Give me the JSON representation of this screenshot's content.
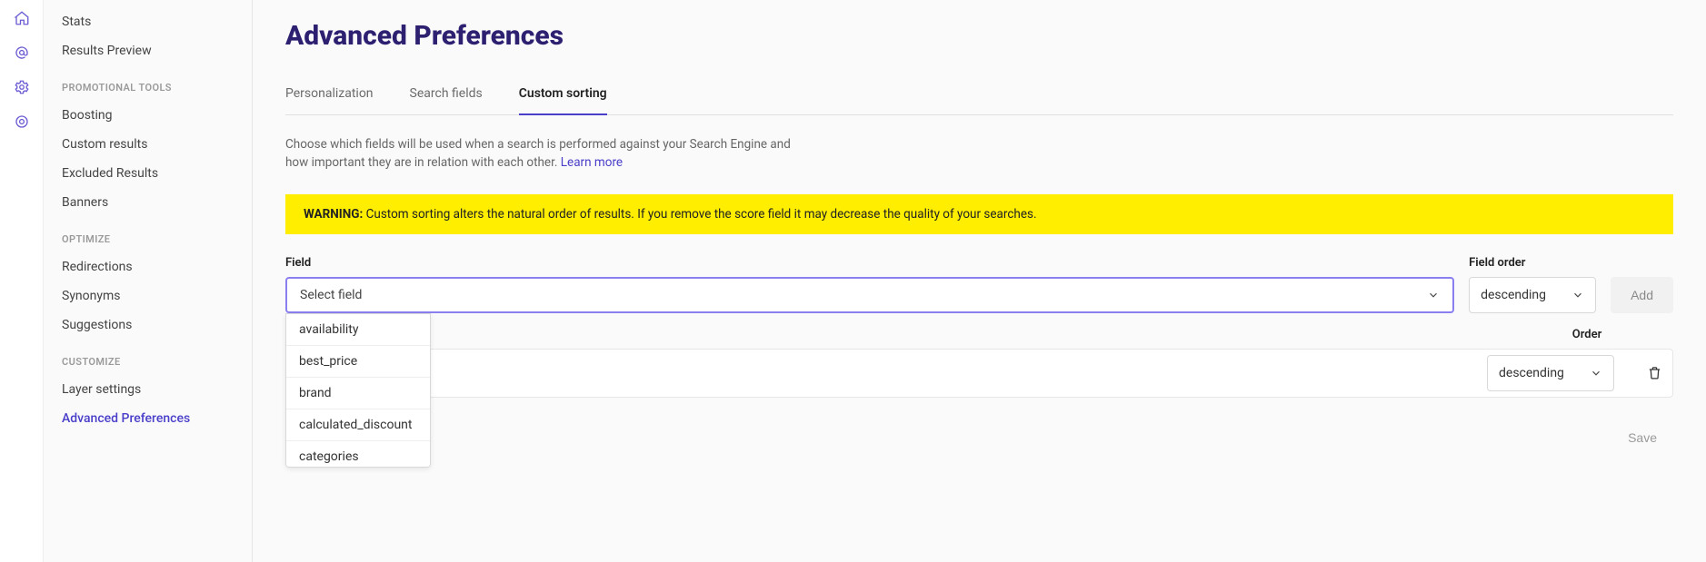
{
  "iconbar": {
    "items": [
      "home-icon",
      "at-icon",
      "gear-icon",
      "target-icon"
    ]
  },
  "sidebar": {
    "groups": [
      {
        "label": null,
        "items": [
          {
            "label": "Stats",
            "active": false
          },
          {
            "label": "Results Preview",
            "active": false
          }
        ]
      },
      {
        "label": "PROMOTIONAL TOOLS",
        "items": [
          {
            "label": "Boosting",
            "active": false
          },
          {
            "label": "Custom results",
            "active": false
          },
          {
            "label": "Excluded Results",
            "active": false
          },
          {
            "label": "Banners",
            "active": false
          }
        ]
      },
      {
        "label": "OPTIMIZE",
        "items": [
          {
            "label": "Redirections",
            "active": false
          },
          {
            "label": "Synonyms",
            "active": false
          },
          {
            "label": "Suggestions",
            "active": false
          }
        ]
      },
      {
        "label": "CUSTOMIZE",
        "items": [
          {
            "label": "Layer settings",
            "active": false
          },
          {
            "label": "Advanced Preferences",
            "active": true
          }
        ]
      }
    ]
  },
  "page": {
    "title": "Advanced Preferences",
    "tabs": [
      {
        "label": "Personalization",
        "active": false
      },
      {
        "label": "Search fields",
        "active": false
      },
      {
        "label": "Custom sorting",
        "active": true
      }
    ],
    "description": "Choose which fields will be used when a search is performed against your Search Engine and how important they are in relation with each other. ",
    "learn_more": "Learn more",
    "warning_prefix": "WARNING:",
    "warning_text": " Custom sorting alters the natural order of results. If you remove the score field it may decrease the quality of your searches.",
    "field_label": "Field",
    "field_order_label": "Field order",
    "field_placeholder": "Select field",
    "field_order_value": "descending",
    "add_label": "Add",
    "dropdown_options": [
      "availability",
      "best_price",
      "brand",
      "calculated_discount",
      "categories"
    ],
    "table": {
      "order_header": "Order",
      "rows": [
        {
          "field": "",
          "order": "descending"
        }
      ]
    },
    "save_label": "Save"
  }
}
